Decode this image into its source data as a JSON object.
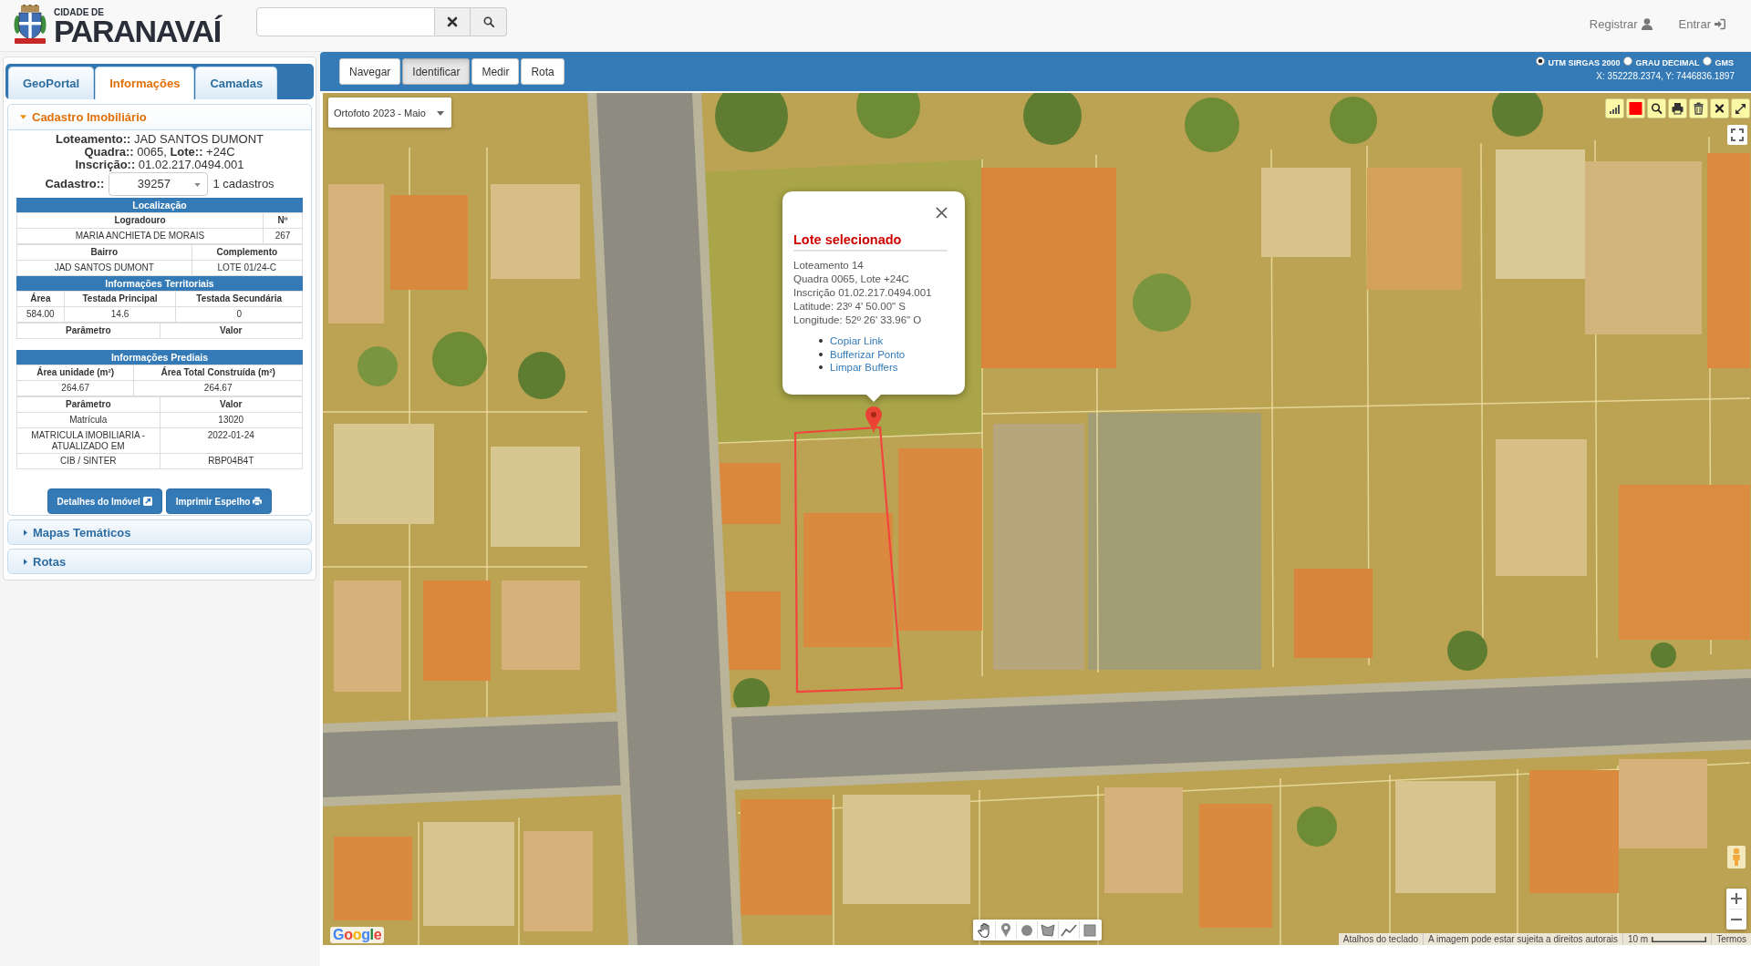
{
  "header": {
    "logo": {
      "line1": "CIDADE DE",
      "line2": "PARANAVAÍ"
    },
    "account_links": [
      {
        "label": "Registrar",
        "kind": "register"
      },
      {
        "label": "Entrar",
        "kind": "login"
      }
    ]
  },
  "sidebar": {
    "tabs": [
      {
        "label": "GeoPortal",
        "selected": false
      },
      {
        "label": "Informações",
        "selected": true
      },
      {
        "label": "Camadas",
        "selected": false
      }
    ],
    "sections": [
      {
        "title": "Cadastro Imobiliário",
        "expanded": true,
        "content": {
          "summary": [
            "**Loteamento::** JAD SANTOS DUMONT",
            "**Quadra::** 0065, **Lote::** +24C",
            "**Inscrição::** 01.02.217.0494.001"
          ],
          "cadastro": {
            "label": "Cadastro::",
            "value": "39257",
            "count": "1 cadastros"
          },
          "tables": [
            {
              "sections": [
                {
                  "title": "Localização",
                  "groups": [
                    {
                      "kind": "fields",
                      "header": [
                        "Logradouro",
                        "Nº"
                      ],
                      "rows": [
                        [
                          "MARIA ANCHIETA DE MORAIS",
                          "267"
                        ]
                      ]
                    },
                    {
                      "kind": "fields",
                      "header": [
                        "Bairro",
                        "Complemento"
                      ],
                      "rows": [
                        [
                          "JAD SANTOS DUMONT",
                          "LOTE 01/24-C"
                        ]
                      ]
                    }
                  ]
                },
                {
                  "title": "Informações Territoriais",
                  "groups": [
                    {
                      "kind": "fields",
                      "header": [
                        "Área",
                        "Testada Principal",
                        "Testada Secundária"
                      ],
                      "rows": [
                        [
                          "584.00",
                          "14.6",
                          "0"
                        ]
                      ]
                    },
                    {
                      "kind": "parameters",
                      "header": [
                        "Parâmetro",
                        "Valor"
                      ]
                    }
                  ]
                }
              ]
            },
            {
              "sections": [
                {
                  "title": "Informações Prediais",
                  "groups": [
                    {
                      "kind": "fields",
                      "header": [
                        "Área unidade (m²)",
                        "Área Total Construída (m²)"
                      ],
                      "rows": [
                        [
                          "264.67",
                          "264.67"
                        ]
                      ]
                    },
                    {
                      "kind": "parameters",
                      "header": [
                        "Parâmetro",
                        "Valor"
                      ],
                      "rows": [
                        [
                          "Matrícula",
                          "13020"
                        ],
                        [
                          "MATRICULA IMOBILIARIA - ATUALIZADO EM",
                          "2022-01-24"
                        ],
                        [
                          "CIB / SINTER",
                          "RBP04B4T"
                        ]
                      ]
                    }
                  ]
                }
              ]
            }
          ],
          "buttons": [
            {
              "label": "Detalhes do Imóvel",
              "kind": "external"
            },
            {
              "label": "Imprimir Espelho",
              "kind": "print"
            }
          ]
        }
      },
      {
        "title": "Mapas Temáticos",
        "expanded": false
      },
      {
        "title": "Rotas",
        "expanded": false
      }
    ]
  },
  "map_toolbar": {
    "modes": [
      {
        "label": "Navegar",
        "selected": false
      },
      {
        "label": "Identificar",
        "selected": true
      },
      {
        "label": "Medir",
        "selected": false
      },
      {
        "label": "Rota",
        "selected": false
      }
    ],
    "coordinate_systems": [
      {
        "label": "UTM SIRGAS 2000",
        "selected": true
      },
      {
        "label": "GRAU DECIMAL",
        "selected": false
      },
      {
        "label": "GMS",
        "selected": false
      }
    ],
    "coordinates": "X: 352228.2374, Y: 7446836.1897"
  },
  "map": {
    "basemap": "Ortofoto 2023 - Maio",
    "popup": {
      "title": "Lote selecionado",
      "lines": [
        "Loteamento 14",
        "Quadra 0065, Lote +24C",
        "Inscrição 01.02.217.0494.001",
        "Latitude: 23º 4' 50.00\" S",
        "Longitude: 52º 26' 33.96\" O"
      ],
      "links": [
        "Copiar Link",
        "Bufferizar Ponto",
        "Limpar Buffers"
      ]
    },
    "google_logo": "Google",
    "keyboard_shortcuts": "Atalhos do teclado",
    "imagery_notice": "A imagem pode estar sujeita a direitos autorais",
    "scale": "10 m",
    "terms": "Termos"
  }
}
